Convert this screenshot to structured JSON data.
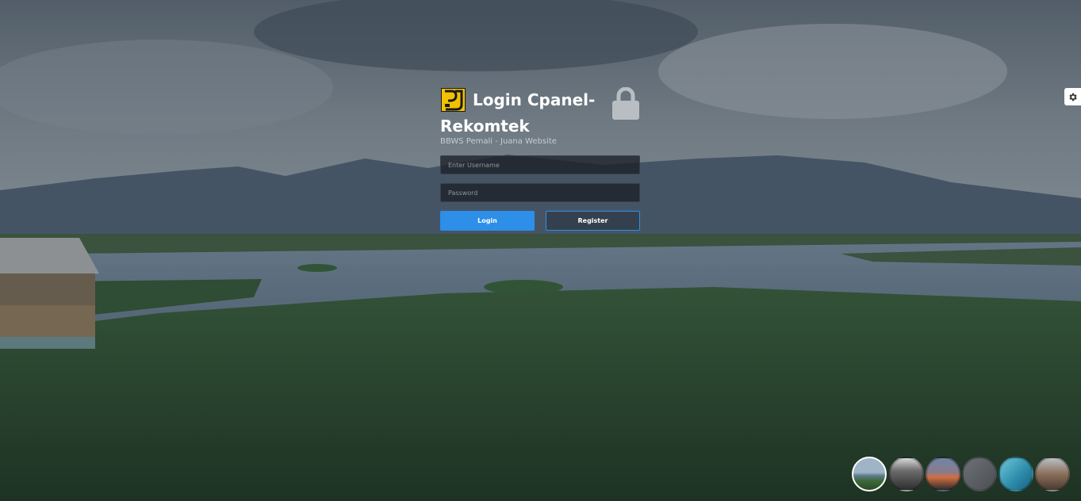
{
  "login": {
    "title": "Login Cpanel-Rekomtek",
    "subtitle": "BBWS Pemali - Juana Website",
    "username_placeholder": "Enter Username",
    "password_placeholder": "Password",
    "login_label": "Login",
    "register_label": "Register"
  },
  "icons": {
    "logo": "pu-logo-icon",
    "lock": "lock-icon",
    "settings": "gear-icon"
  },
  "colors": {
    "accent": "#2d8fe8",
    "logo_yellow": "#f2c200"
  },
  "backgrounds": {
    "selected_index": 0,
    "options": [
      "lake-landscape",
      "dark-horizon",
      "sunset-mountains",
      "grey-abstract",
      "teal-aerial",
      "mountain-peak"
    ]
  }
}
